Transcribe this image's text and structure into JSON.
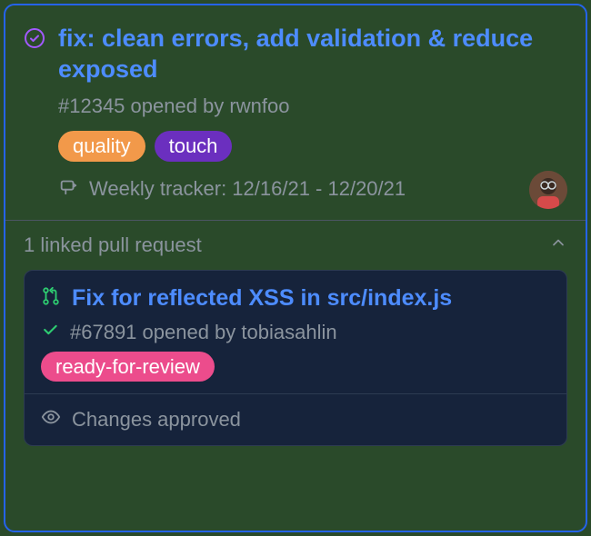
{
  "issue": {
    "title": "fix: clean errors, add validation & reduce exposed",
    "meta": "#12345 opened by rwnfoo",
    "labels": [
      {
        "text": "quality",
        "cls": "label-orange"
      },
      {
        "text": "touch",
        "cls": "label-purple"
      }
    ],
    "tracker": "Weekly tracker: 12/16/21 - 12/20/21"
  },
  "linked": {
    "header": "1 linked pull request"
  },
  "pr": {
    "title": "Fix for reflected XSS in src/index.js",
    "meta": "#67891 opened by tobiasahlin",
    "labels": [
      {
        "text": "ready-for-review",
        "cls": "label-pink"
      }
    ],
    "status": "Changes approved"
  },
  "colors": {
    "pr_icon": "#2ecc71",
    "link": "#4d8cff",
    "circle_check": "#a259ff"
  }
}
